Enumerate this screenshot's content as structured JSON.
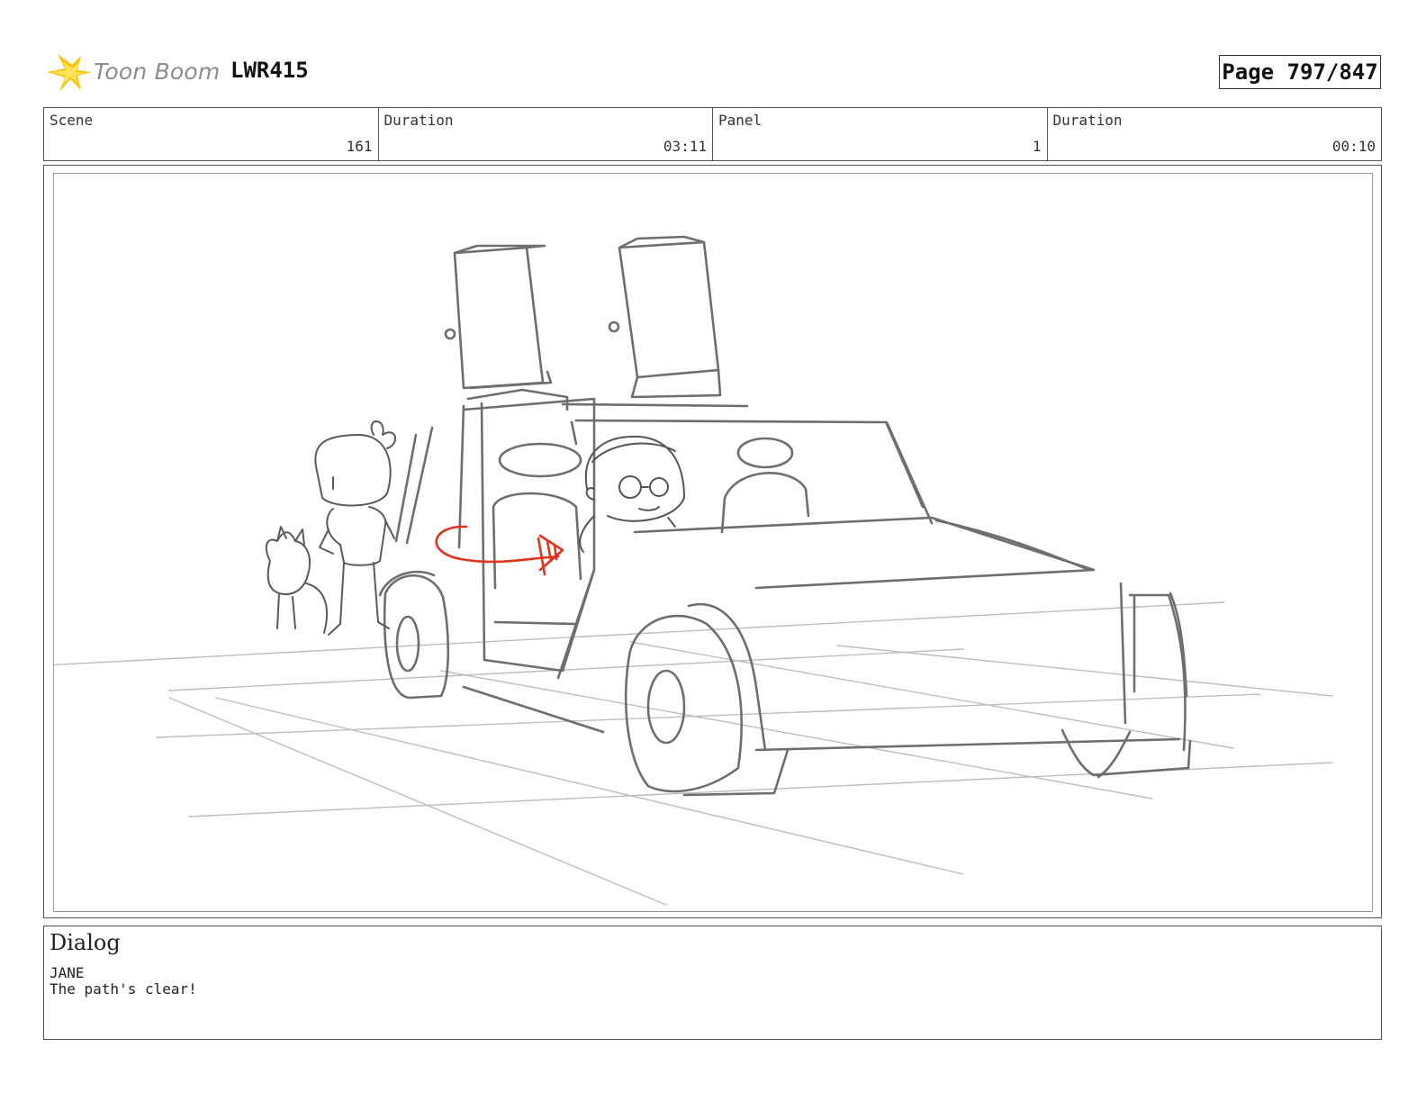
{
  "header": {
    "logo_text": "Toon Boom",
    "project_code": "LWR415",
    "page_label": "Page 797/847"
  },
  "info": {
    "scene_label": "Scene",
    "scene_value": "161",
    "scene_duration_label": "Duration",
    "scene_duration_value": "03:11",
    "panel_label": "Panel",
    "panel_value": "1",
    "panel_duration_label": "Duration",
    "panel_duration_value": "00:10"
  },
  "dialog": {
    "title": "Dialog",
    "speaker": "JANE",
    "line": "The path's clear!"
  },
  "colors": {
    "sketch": "#6e6e6e",
    "ground": "#b8b8b8",
    "arrow": "#e0341c",
    "logo_star": "#f5c400"
  },
  "icons": {
    "logo": "toon-boom-star-icon",
    "drawing": "storyboard-sketch"
  }
}
